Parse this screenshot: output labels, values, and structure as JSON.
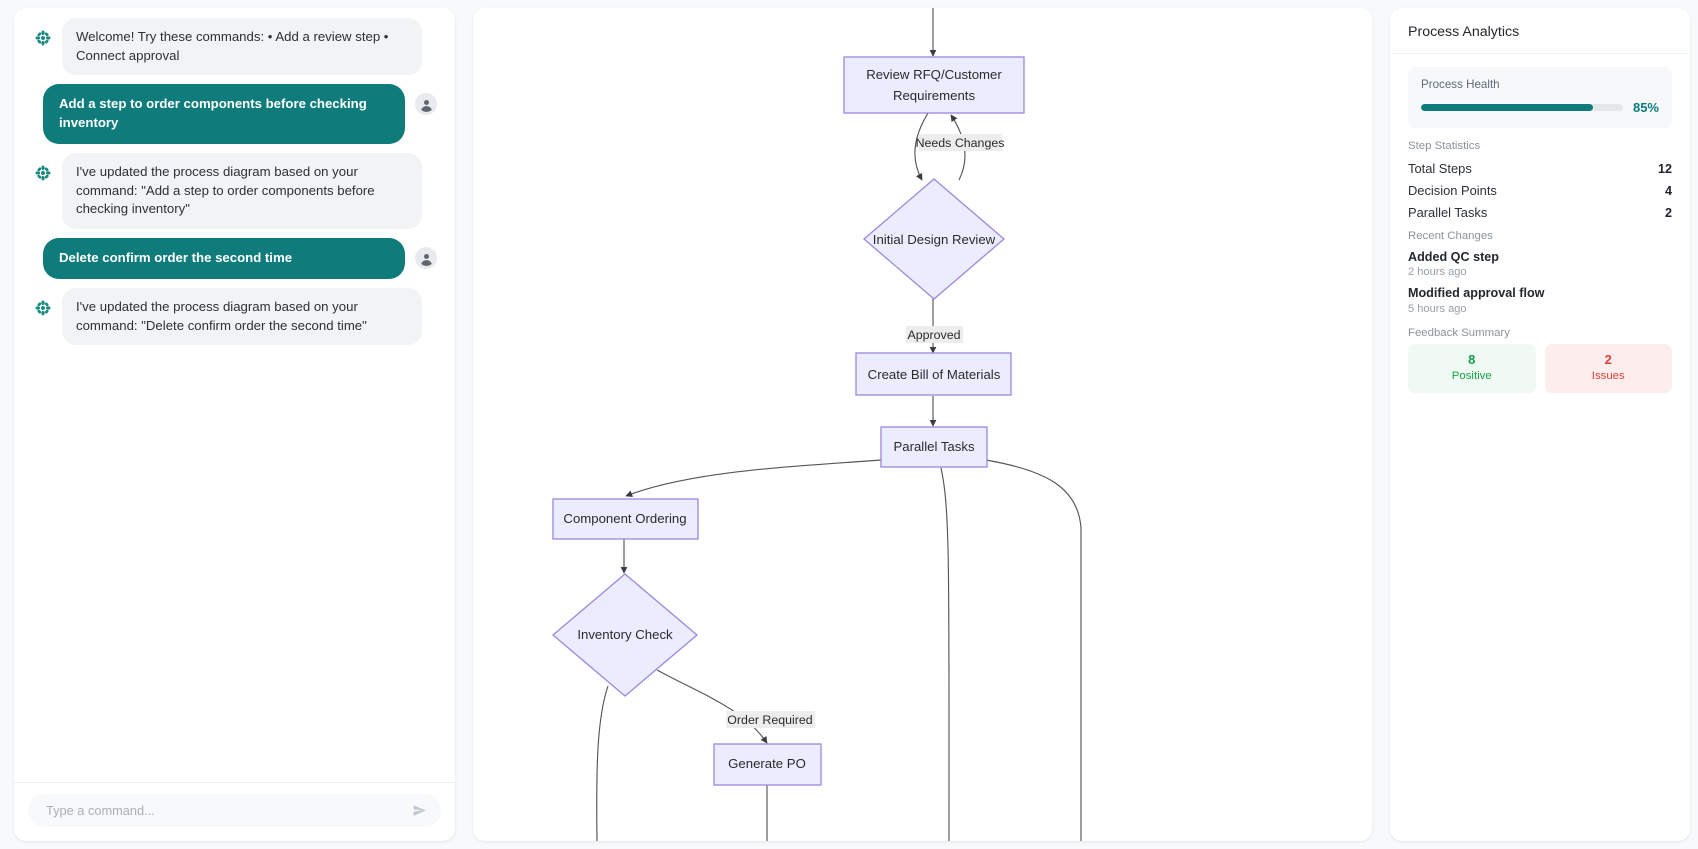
{
  "chat": {
    "messages": [
      {
        "role": "bot",
        "icon": "bot-flower-icon",
        "text": "Welcome! Try these commands: • Add a review step • Connect approval"
      },
      {
        "role": "user",
        "icon": "user-avatar-icon",
        "text": "Add a step to order components before checking inventory"
      },
      {
        "role": "bot",
        "icon": "bot-flower-icon",
        "text": "I've updated the process diagram based on your command: \"Add a step to order components before checking inventory\""
      },
      {
        "role": "user",
        "icon": "user-avatar-icon",
        "text": "Delete confirm order the second time"
      },
      {
        "role": "bot",
        "icon": "bot-flower-icon",
        "text": "I've updated the process diagram based on your command: \"Delete confirm order the second time\""
      }
    ],
    "input": {
      "value": "",
      "placeholder": "Type a command...",
      "send_icon": "send-arrow-icon"
    },
    "colors": {
      "user_bubble": "#0f7b7b",
      "bot_bubble": "#f1f3f4"
    }
  },
  "diagram": {
    "nodes": [
      {
        "id": "review_rfq",
        "label": "Review RFQ/Customer Requirements",
        "shape": "rect"
      },
      {
        "id": "initial_design_review",
        "label": "Initial Design Review",
        "shape": "diamond"
      },
      {
        "id": "create_bom",
        "label": "Create Bill of Materials",
        "shape": "rect"
      },
      {
        "id": "parallel_tasks",
        "label": "Parallel Tasks",
        "shape": "rect"
      },
      {
        "id": "component_ordering",
        "label": "Component Ordering",
        "shape": "rect"
      },
      {
        "id": "inventory_check",
        "label": "Inventory Check",
        "shape": "diamond"
      },
      {
        "id": "generate_po",
        "label": "Generate PO",
        "shape": "rect"
      }
    ],
    "edge_labels": [
      {
        "id": "needs_changes",
        "label": "Needs Changes"
      },
      {
        "id": "approved",
        "label": "Approved"
      },
      {
        "id": "order_required",
        "label": "Order Required"
      }
    ],
    "colors": {
      "node_fill": "#ececff",
      "node_stroke": "#9e86df",
      "edge_stroke": "#54565c",
      "label_bg": "#ededed"
    }
  },
  "analytics": {
    "title": "Process Analytics",
    "health": {
      "label": "Process Health",
      "percent_text": "85%",
      "percent_value": 85,
      "color": "#0d7b7b"
    },
    "step_statistics": {
      "section_label": "Step Statistics",
      "rows": [
        {
          "label": "Total Steps",
          "value": "12"
        },
        {
          "label": "Decision Points",
          "value": "4"
        },
        {
          "label": "Parallel Tasks",
          "value": "2"
        }
      ]
    },
    "recent_changes": {
      "section_label": "Recent Changes",
      "items": [
        {
          "title": "Added QC step",
          "time": "2 hours ago"
        },
        {
          "title": "Modified approval flow",
          "time": "5 hours ago"
        }
      ]
    },
    "feedback": {
      "section_label": "Feedback Summary",
      "cards": [
        {
          "count": "8",
          "caption": "Positive",
          "color": "#17a24a"
        },
        {
          "count": "2",
          "caption": "Issues",
          "color": "#e0413c"
        }
      ]
    }
  }
}
